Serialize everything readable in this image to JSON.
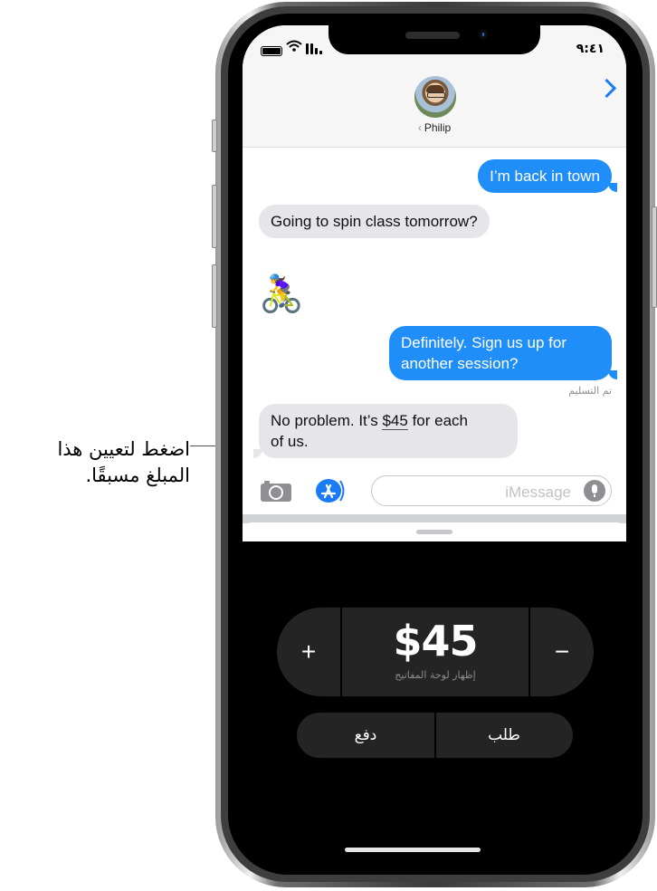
{
  "callout": {
    "line1": "اضغط لتعيين هذا",
    "line2": "المبلغ مسبقًا."
  },
  "status_bar": {
    "time": "٩:٤١",
    "icons": [
      "battery-icon",
      "wifi-icon",
      "signal-icon"
    ]
  },
  "header": {
    "contact_name": "Philip",
    "back_glyph": "‹",
    "forward_icon": "chevron-right-icon",
    "accent_color": "#1a7cf5"
  },
  "messages": [
    {
      "direction": "outgoing",
      "text": "I’m back in town"
    },
    {
      "direction": "incoming",
      "text": "Going to spin class tomorrow?"
    },
    {
      "direction": "incoming",
      "emoji": "🚴‍♀️"
    },
    {
      "direction": "outgoing",
      "text_line1": "Definitely. Sign us up for",
      "text_line2": "another session?"
    },
    {
      "direction": "incoming",
      "text_before": "No problem. It’s ",
      "amount": "$45",
      "text_after": " for each",
      "text_line2": "of us."
    }
  ],
  "delivered_label": "تم التسليم",
  "input_bar": {
    "placeholder": "iMessage",
    "camera_icon": "camera-icon",
    "apps_icon": "app-store-icon",
    "mic_icon": "microphone-icon"
  },
  "apple_pay_panel": {
    "plus_label": "+",
    "minus_label": "−",
    "amount": "$45",
    "show_keyboard_label": "إظهار لوحة المفاتيح",
    "pay_label": "دفع",
    "request_label": "طلب"
  },
  "colors": {
    "outgoing_bubble": "#1f8ef8",
    "incoming_bubble": "#e5e5ea",
    "panel_bg": "#000000",
    "panel_button": "#242424"
  }
}
